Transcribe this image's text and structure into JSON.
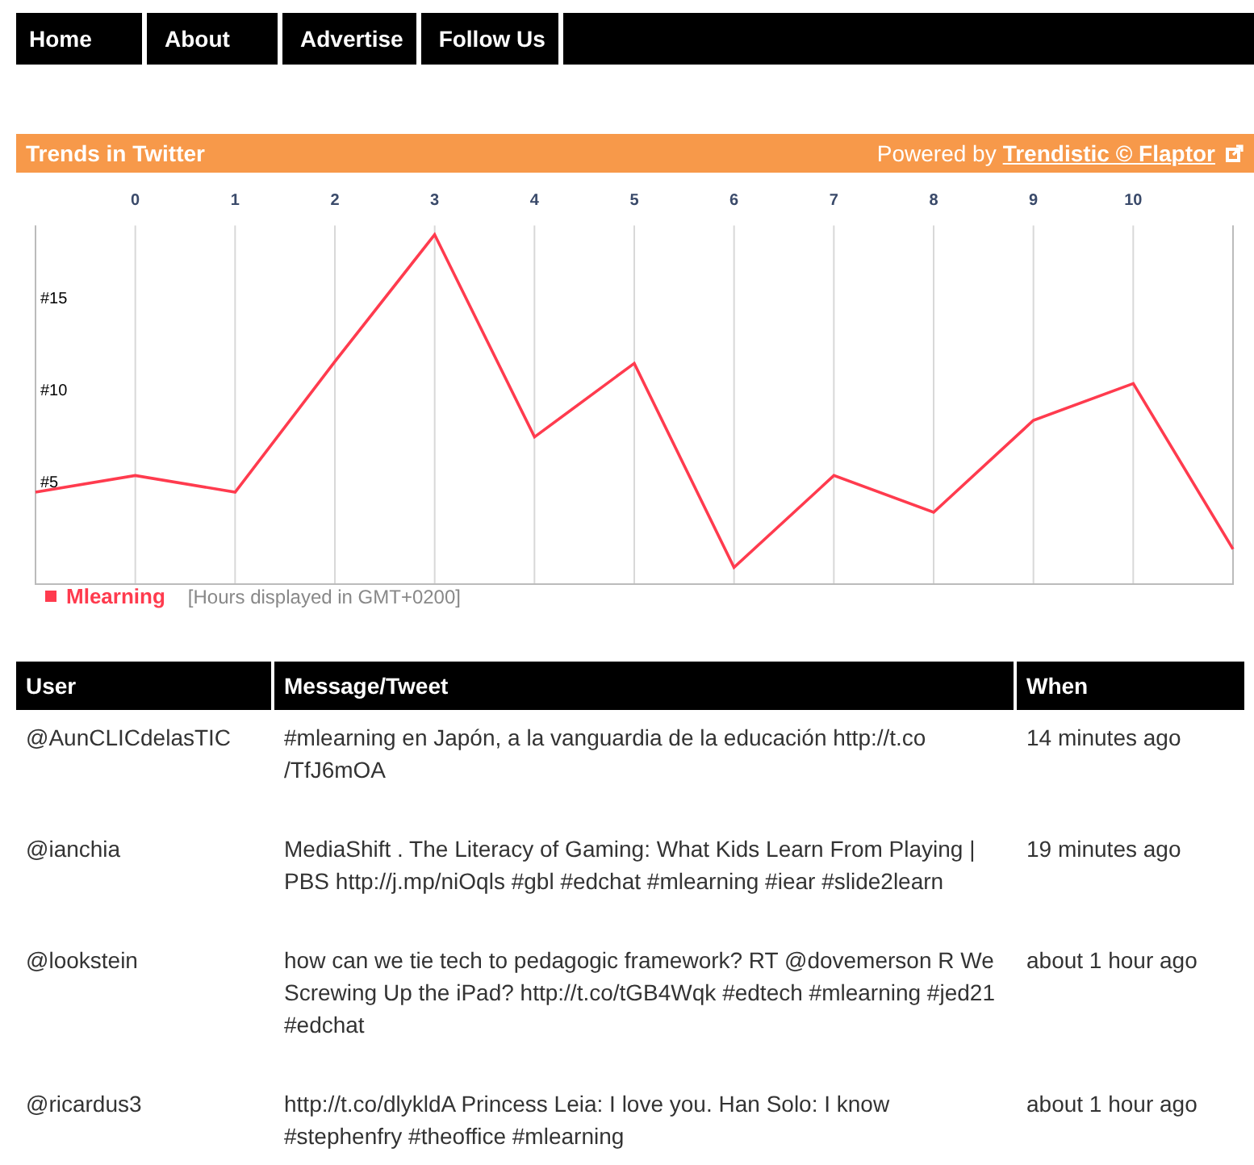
{
  "nav": [
    {
      "label": "Home"
    },
    {
      "label": "About"
    },
    {
      "label": "Advertise"
    },
    {
      "label": "Follow Us"
    }
  ],
  "trends": {
    "title": "Trends in Twitter",
    "powered_prefix": "Powered by",
    "powered_link": "Trendistic © Flaptor",
    "chart_data": {
      "type": "line",
      "x": [
        -1,
        0,
        1,
        2,
        3,
        4,
        5,
        6,
        7,
        8,
        9,
        10,
        11
      ],
      "grid": true,
      "xlim": [
        -1,
        11
      ],
      "ylim": [
        -0.5,
        19
      ],
      "xticks": [
        0,
        1,
        2,
        3,
        4,
        5,
        6,
        7,
        8,
        9,
        10
      ],
      "yticks": [
        {
          "value": 5,
          "label": "#5"
        },
        {
          "value": 10,
          "label": "#10"
        },
        {
          "value": 15,
          "label": "#15"
        }
      ],
      "series": [
        {
          "name": "Mlearning",
          "color": "#ff3b4e",
          "values": [
            4.5,
            5.4,
            4.5,
            11.6,
            18.5,
            7.5,
            11.5,
            0.4,
            5.4,
            3.4,
            8.4,
            10.4,
            1.4
          ]
        }
      ]
    },
    "note": "[Hours displayed in GMT+0200]"
  },
  "table": {
    "columns": [
      "User",
      "Message/Tweet",
      "When"
    ],
    "rows": [
      {
        "user": "@AunCLICdelasTIC",
        "message": "#mlearning en Japón, a la vanguardia de la educación http://t.co /TfJ6mOA",
        "when": "14 minutes ago"
      },
      {
        "user": "@ianchia",
        "message": "MediaShift . The Literacy of Gaming: What Kids Learn From Playing | PBS http://j.mp/niOqls #gbl #edchat #mlearning #iear #slide2learn",
        "when": "19 minutes ago"
      },
      {
        "user": "@lookstein",
        "message": "how can we tie tech to pedagogic framework? RT @dovemerson R We Screwing Up the iPad? http://t.co/tGB4Wqk #edtech #mlearning #jed21 #edchat",
        "when": "about 1 hour ago"
      },
      {
        "user": "@ricardus3",
        "message": "http://t.co/dlykldA Princess Leia: I love you. Han Solo: I know #stephenfry #theoffice #mlearning",
        "when": "about 1 hour ago"
      }
    ]
  }
}
